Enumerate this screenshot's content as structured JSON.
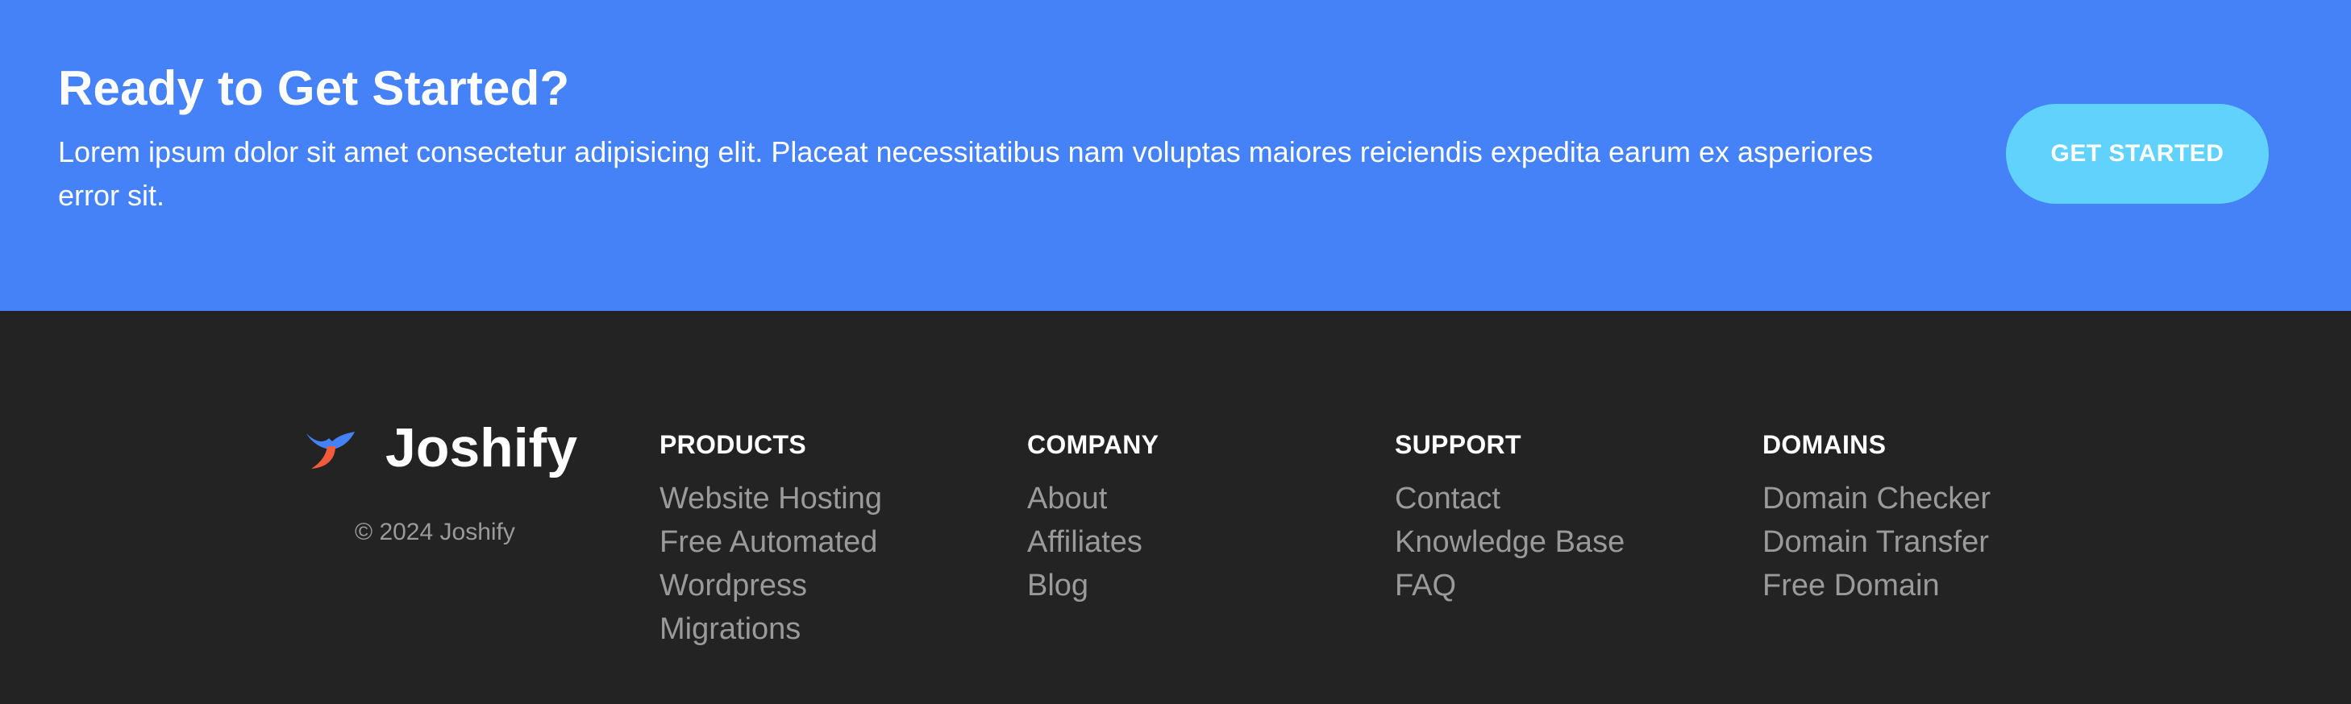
{
  "cta": {
    "heading": "Ready to Get Started?",
    "text": "Lorem ipsum dolor sit amet consectetur adipisicing elit. Placeat necessitatibus nam voluptas maiores reiciendis expedita earum ex asperiores error sit.",
    "button_label": "GET STARTED"
  },
  "footer": {
    "brand": {
      "name": "Joshify",
      "copyright": "© 2024 Joshify"
    },
    "columns": [
      {
        "heading": "PRODUCTS",
        "links": [
          "Website Hosting",
          "Free Automated",
          "Wordpress",
          "Migrations"
        ]
      },
      {
        "heading": "COMPANY",
        "links": [
          "About",
          "Affiliates",
          "Blog"
        ]
      },
      {
        "heading": "SUPPORT",
        "links": [
          "Contact",
          "Knowledge Base",
          "FAQ"
        ]
      },
      {
        "heading": "DOMAINS",
        "links": [
          "Domain Checker",
          "Domain Transfer",
          "Free Domain"
        ]
      }
    ]
  },
  "colors": {
    "cta_background": "#4582f7",
    "cta_button": "#60d2fb",
    "footer_background": "#232323",
    "link_gray": "#9a9a9a",
    "logo_blue": "#4582f7",
    "logo_orange": "#f15a3a"
  },
  "icons": {
    "brand_logo": "bird-logo-icon"
  }
}
